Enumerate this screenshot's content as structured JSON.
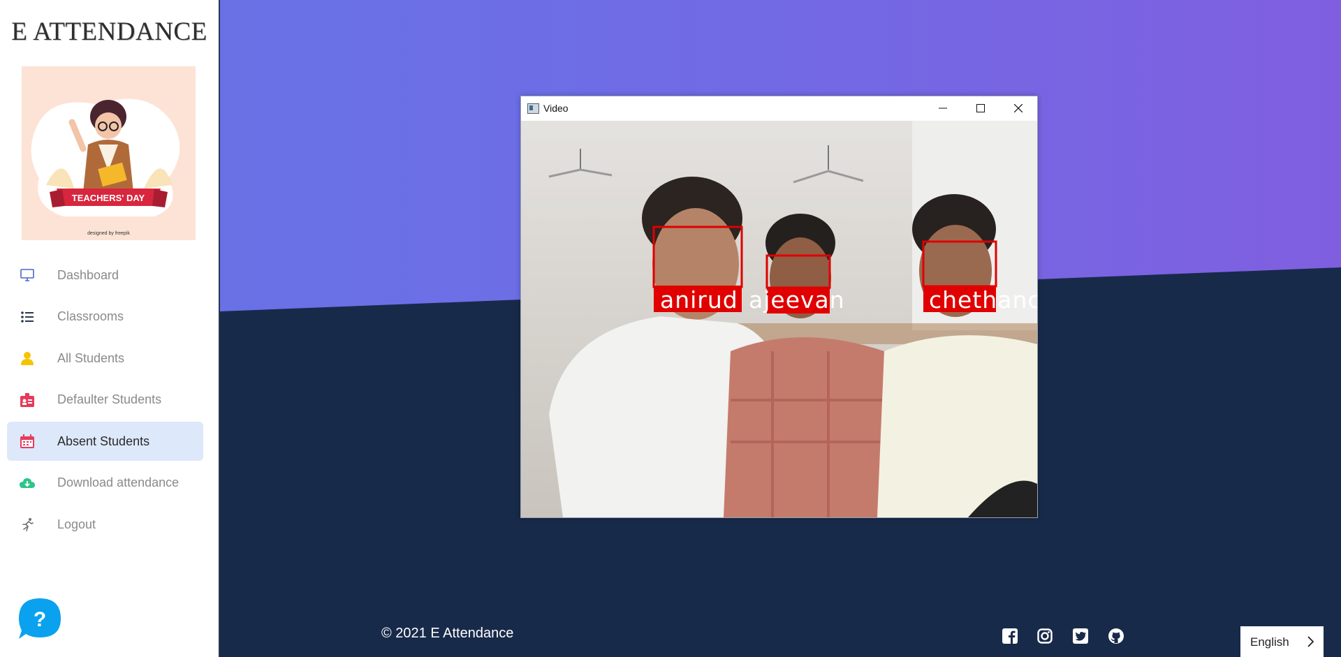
{
  "brand": {
    "title": "E ATTENDANCE"
  },
  "hero": {
    "banner_text": "TEACHERS' DAY",
    "credit": "designed by freepik"
  },
  "nav": {
    "items": [
      {
        "label": "Dashboard",
        "icon": "monitor-icon",
        "color": "#4a66c9",
        "active": false
      },
      {
        "label": "Classrooms",
        "icon": "list-icon",
        "color": "#2a3550",
        "active": false
      },
      {
        "label": "All Students",
        "icon": "user-icon",
        "color": "#f5c400",
        "active": false
      },
      {
        "label": "Defaulter Students",
        "icon": "id-card-icon",
        "color": "#e73b5c",
        "active": false
      },
      {
        "label": "Absent Students",
        "icon": "calendar-icon",
        "color": "#e73b5c",
        "active": true
      },
      {
        "label": "Download attendance",
        "icon": "cloud-download-icon",
        "color": "#2fc58a",
        "active": false
      },
      {
        "label": "Logout",
        "icon": "running-man-icon",
        "color": "#6d6d6d",
        "active": false
      }
    ]
  },
  "help": {
    "label": "?"
  },
  "video_window": {
    "title": "Video",
    "faces": [
      {
        "name": "anirud"
      },
      {
        "name": "ajeevan"
      },
      {
        "name": "chethanc"
      }
    ]
  },
  "footer": {
    "copyright": "© 2021 E Attendance",
    "social": [
      "facebook-icon",
      "instagram-icon",
      "twitter-icon",
      "github-icon"
    ]
  },
  "language": {
    "label": "English"
  },
  "colors": {
    "gradient_start": "#6673e4",
    "gradient_end": "#7f5fe0",
    "dark_bg": "#182a4a",
    "active_nav_bg": "#dde8fa",
    "face_box": "#e00000"
  }
}
